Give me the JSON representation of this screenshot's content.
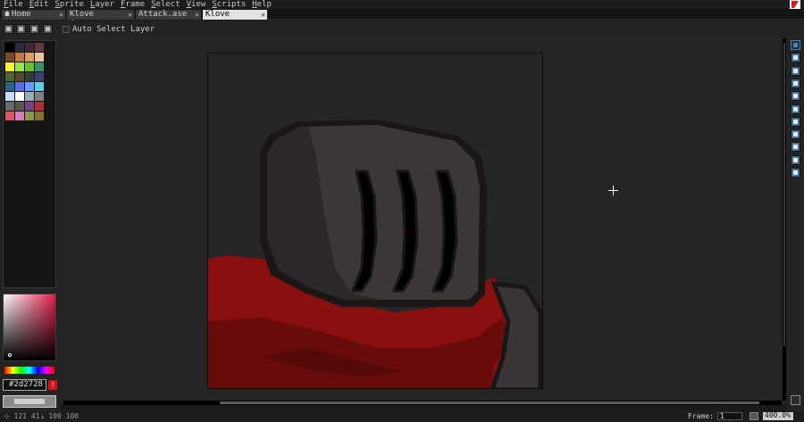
{
  "menu": [
    "File",
    "Edit",
    "Sprite",
    "Layer",
    "Frame",
    "Select",
    "View",
    "Scripts",
    "Help"
  ],
  "tabs": [
    {
      "label": "Home",
      "active": false
    },
    {
      "label": "Klove Cover.as",
      "active": false
    },
    {
      "label": "Attack.ase",
      "active": false
    },
    {
      "label": "Klove Knight.as",
      "active": true
    }
  ],
  "context_bar": {
    "auto_select_label": "Auto Select Layer"
  },
  "palette": {
    "colors": [
      "#000000",
      "#2a2742",
      "#44243a",
      "#5e3a3a",
      "#7a4a2e",
      "#c47a3e",
      "#d9a066",
      "#eec39a",
      "#fbf236",
      "#99e550",
      "#6abe30",
      "#37946e",
      "#4b692f",
      "#524b24",
      "#323c39",
      "#3f3f74",
      "#306082",
      "#5b6ee1",
      "#639bff",
      "#5fcde4",
      "#cbdbfc",
      "#ffffff",
      "#9badb7",
      "#847e87",
      "#696a6a",
      "#595652",
      "#76428a",
      "#ac3232",
      "#d95763",
      "#d77bba",
      "#8f974a",
      "#8a6f30"
    ]
  },
  "color_picker": {
    "hex_value": "#2d2728",
    "warning_icon": "!"
  },
  "status_bar": {
    "coords": "121 41",
    "size": "100 100",
    "frame_label": "Frame:",
    "frame_value": "1",
    "zoom": "400.0%"
  },
  "toolbar": {
    "tools": [
      "marquee-icon",
      "pencil-icon",
      "eraser-icon",
      "eyedropper-icon",
      "zoom-icon",
      "move-icon",
      "paint-bucket-icon",
      "line-icon",
      "rectangle-icon",
      "contour-icon",
      "blur-icon"
    ]
  },
  "art_colors": {
    "outline": "#1a1616",
    "helmet": "#3c3638",
    "shadow": "#2d2728",
    "cape": "#8a0f0f",
    "cape_dark": "#6a0b0b"
  }
}
